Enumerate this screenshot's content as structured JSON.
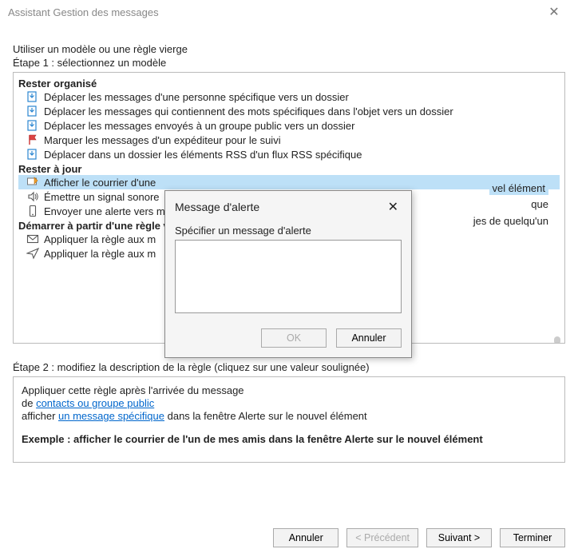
{
  "window": {
    "title": "Assistant Gestion des messages",
    "close_glyph": "✕"
  },
  "headings": {
    "intro": "Utiliser un modèle ou une règle vierge",
    "step1": "Étape 1 : sélectionnez un modèle",
    "step2": "Étape 2 : modifiez la description de la règle (cliquez sur une valeur soulignée)"
  },
  "categories": {
    "cat1": {
      "label": "Rester organisé"
    },
    "cat2": {
      "label": "Rester à jour"
    },
    "cat3": {
      "label": "Démarrer à partir d'une règle vide"
    }
  },
  "rules": {
    "r1": "Déplacer les messages d'une personne spécifique vers un dossier",
    "r2": "Déplacer les messages qui contiennent des mots spécifiques dans l'objet vers un dossier",
    "r3": "Déplacer les messages envoyés à un groupe public vers un dossier",
    "r4": "Marquer les messages d'un expéditeur pour le suivi",
    "r5": "Déplacer dans un dossier les éléments RSS d'un flux RSS spécifique",
    "r6_pre": "Afficher le courrier d'une",
    "r6_post": "vel élément",
    "r7_pre": "Émettre un signal sonore",
    "r7_post": "que",
    "r8_pre": "Envoyer une alerte vers m",
    "r8_post": "jes de quelqu'un",
    "r9": "Appliquer la règle aux m",
    "r10": "Appliquer la règle aux m"
  },
  "description": {
    "line1": "Appliquer cette règle après l'arrivée du message",
    "line2_pre": "de ",
    "line2_link": "contacts ou groupe public",
    "line3_pre": "afficher ",
    "line3_link": "un message spécifique",
    "line3_post": " dans la fenêtre Alerte sur le nouvel élément",
    "example": "Exemple : afficher le courrier de l'un de mes amis dans la fenêtre Alerte sur le nouvel élément"
  },
  "footer": {
    "cancel": "Annuler",
    "prev": "< Précédent",
    "next": "Suivant >",
    "finish": "Terminer"
  },
  "modal": {
    "title": "Message d'alerte",
    "close_glyph": "✕",
    "label": "Spécifier un message d'alerte",
    "value": "",
    "ok": "OK",
    "cancel": "Annuler"
  }
}
